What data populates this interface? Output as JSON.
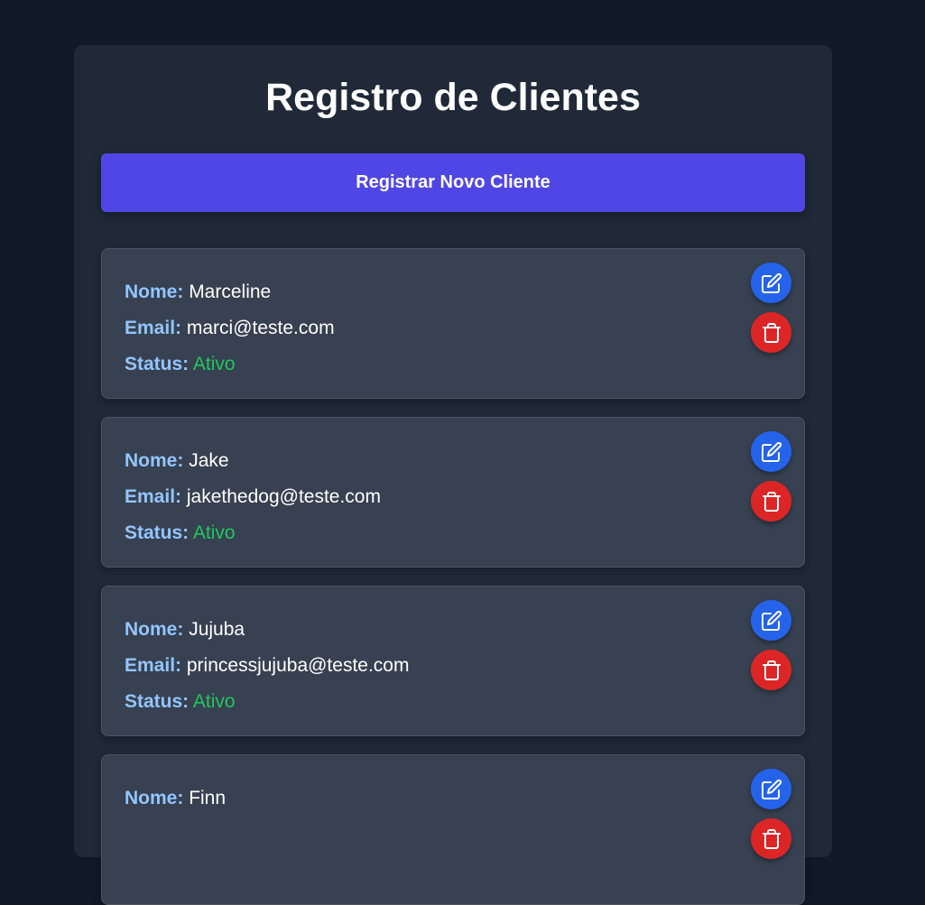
{
  "header": {
    "title": "Registro de Clientes",
    "register_button_label": "Registrar Novo Cliente"
  },
  "labels": {
    "name": "Nome:",
    "email": "Email:",
    "status": "Status:"
  },
  "clients": [
    {
      "name": "Marceline",
      "email": "marci@teste.com",
      "status": "Ativo"
    },
    {
      "name": "Jake",
      "email": "jakethedog@teste.com",
      "status": "Ativo"
    },
    {
      "name": "Jujuba",
      "email": "princessjujuba@teste.com",
      "status": "Ativo"
    },
    {
      "name": "Finn",
      "email": "",
      "status": ""
    }
  ],
  "icons": {
    "edit": "edit-icon",
    "delete": "trash-icon"
  },
  "colors": {
    "background": "#111827",
    "panel": "#1f2937",
    "card": "#374151",
    "primary_button": "#4f46e5",
    "edit_button": "#2563eb",
    "delete_button": "#dc2626",
    "label": "#93c5fd",
    "status_active": "#22c55e"
  }
}
